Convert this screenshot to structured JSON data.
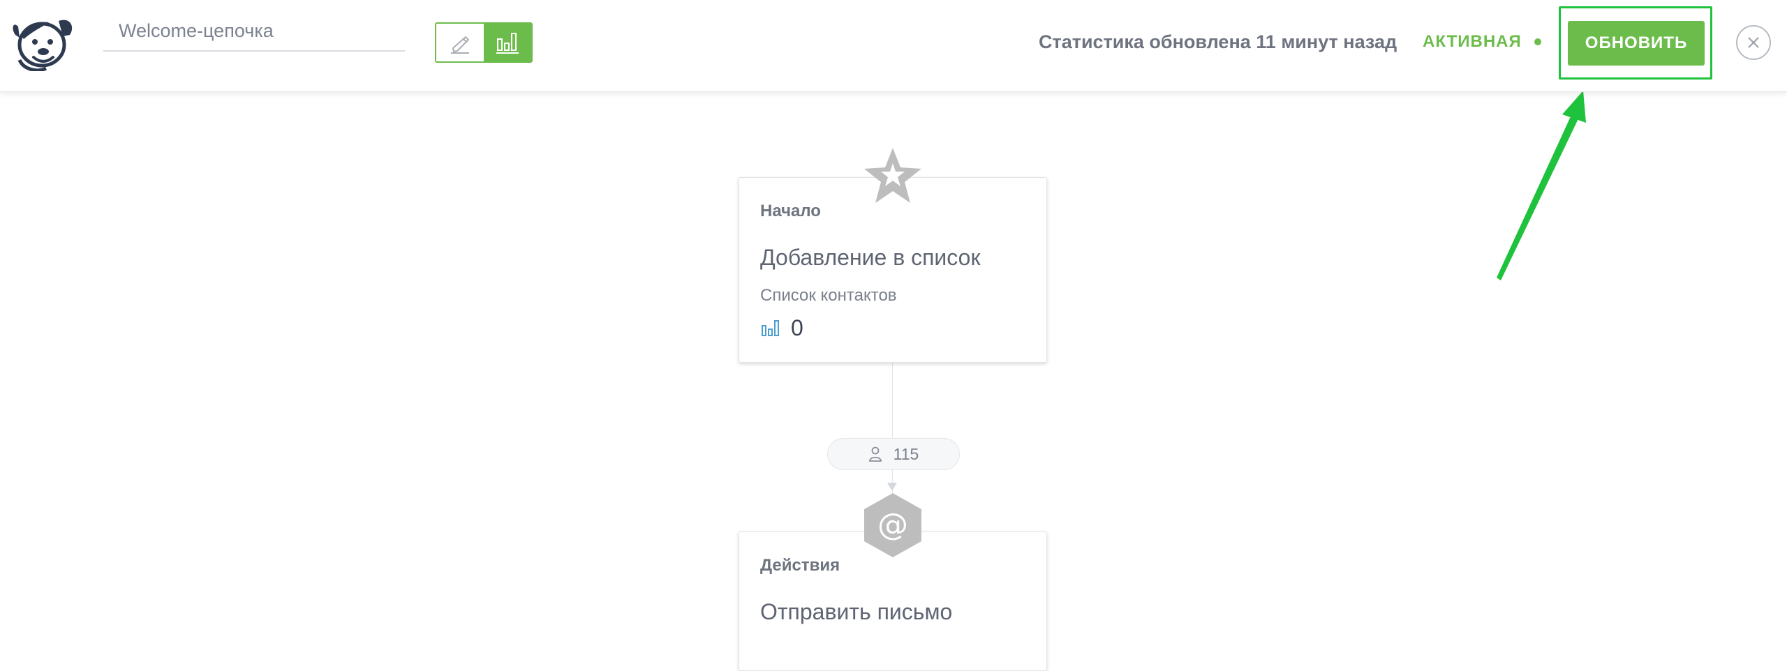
{
  "header": {
    "chain_name": "Welcome-цепочка",
    "stats_updated": "Статистика обновлена 11 минут назад",
    "status_label": "АКТИВНАЯ",
    "refresh_label": "ОБНОВИТЬ",
    "active_mode": "stats"
  },
  "nodes": {
    "start": {
      "kind": "Начало",
      "title": "Добавление в список",
      "subtitle": "Список контактов",
      "stat_value": "0"
    },
    "action": {
      "kind": "Действия",
      "title": "Отправить письмо",
      "icon_glyph": "@"
    }
  },
  "connector": {
    "contacts_count": "115"
  },
  "colors": {
    "accent": "#6cbc4b",
    "annotation": "#1fc23c",
    "icon_grey": "#bdbdbd",
    "stat_icon": "#4a9fd0"
  },
  "icons": {
    "logo": "dog-mascot-logo",
    "edit_mode": "pencil-icon",
    "stats_mode": "bar-chart-icon",
    "close": "close-icon",
    "start_node": "star-icon",
    "action_node": "at-sign-hexagon-icon",
    "counter": "person-icon",
    "stat": "bar-chart-icon"
  }
}
